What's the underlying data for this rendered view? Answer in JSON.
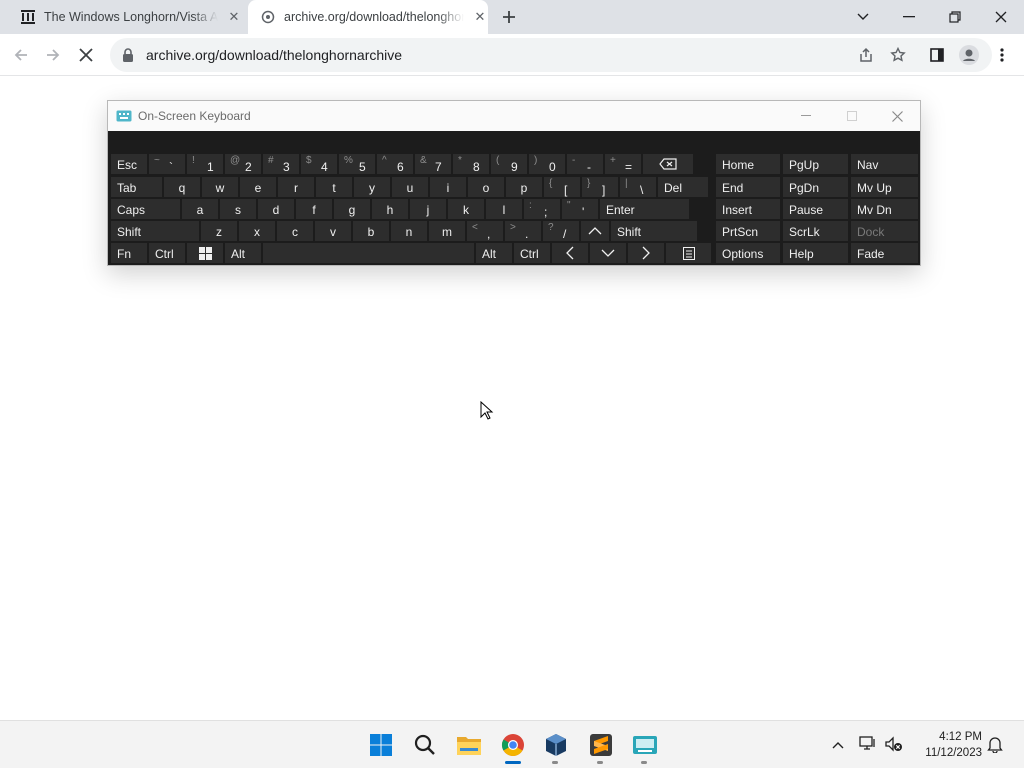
{
  "browser": {
    "tabs": [
      {
        "title": "The Windows Longhorn/Vista Archive",
        "active": false
      },
      {
        "title": "archive.org/download/thelonghornarchive",
        "active": true
      }
    ],
    "new_tab_icon": "plus-icon",
    "address": "archive.org/download/thelonghornarchive",
    "window_controls": [
      "chevron-down-icon",
      "minimize-icon",
      "restore-icon",
      "close-icon"
    ],
    "toolbar_icons": [
      "share-icon",
      "star-icon",
      "side-panel-icon",
      "profile-icon",
      "menu-icon"
    ]
  },
  "osk": {
    "title": "On-Screen Keyboard",
    "rows": [
      [
        {
          "l": "Esc"
        },
        {
          "s": "~",
          "m": "`"
        },
        {
          "s": "!",
          "m": "1"
        },
        {
          "s": "@",
          "m": "2"
        },
        {
          "s": "#",
          "m": "3"
        },
        {
          "s": "$",
          "m": "4"
        },
        {
          "s": "%",
          "m": "5"
        },
        {
          "s": "^",
          "m": "6"
        },
        {
          "s": "&",
          "m": "7"
        },
        {
          "s": "*",
          "m": "8"
        },
        {
          "s": "(",
          "m": "9"
        },
        {
          "s": ")",
          "m": "0"
        },
        {
          "s": "-",
          "m": "-"
        },
        {
          "s": "+",
          "m": "="
        },
        {
          "icon": "backspace-icon"
        }
      ],
      [
        {
          "l": "Tab"
        },
        {
          "l": "q"
        },
        {
          "l": "w"
        },
        {
          "l": "e"
        },
        {
          "l": "r"
        },
        {
          "l": "t"
        },
        {
          "l": "y"
        },
        {
          "l": "u"
        },
        {
          "l": "i"
        },
        {
          "l": "o"
        },
        {
          "l": "p"
        },
        {
          "s": "{",
          "m": "["
        },
        {
          "s": "}",
          "m": "]"
        },
        {
          "s": "|",
          "m": "\\"
        },
        {
          "l": "Del"
        }
      ],
      [
        {
          "l": "Caps"
        },
        {
          "l": "a"
        },
        {
          "l": "s"
        },
        {
          "l": "d"
        },
        {
          "l": "f"
        },
        {
          "l": "g"
        },
        {
          "l": "h"
        },
        {
          "l": "j"
        },
        {
          "l": "k"
        },
        {
          "l": "l"
        },
        {
          "s": ":",
          "m": ";"
        },
        {
          "s": "\"",
          "m": "'"
        },
        {
          "l": "Enter"
        }
      ],
      [
        {
          "l": "Shift"
        },
        {
          "l": "z"
        },
        {
          "l": "x"
        },
        {
          "l": "c"
        },
        {
          "l": "v"
        },
        {
          "l": "b"
        },
        {
          "l": "n"
        },
        {
          "l": "m"
        },
        {
          "s": "<",
          "m": ","
        },
        {
          "s": ">",
          "m": "."
        },
        {
          "s": "?",
          "m": "/"
        },
        {
          "icon": "arrow-up-icon"
        },
        {
          "l": "Shift"
        }
      ],
      [
        {
          "l": "Fn"
        },
        {
          "l": "Ctrl"
        },
        {
          "icon": "windows-icon"
        },
        {
          "l": "Alt"
        },
        {
          "l": ""
        },
        {
          "l": "Alt"
        },
        {
          "l": "Ctrl"
        },
        {
          "icon": "arrow-left-icon"
        },
        {
          "icon": "arrow-down-icon"
        },
        {
          "icon": "arrow-right-icon"
        },
        {
          "icon": "context-menu-icon"
        }
      ]
    ],
    "nav_keys": [
      [
        "Home",
        "PgUp",
        "Nav"
      ],
      [
        "End",
        "PgDn",
        "Mv Up"
      ],
      [
        "Insert",
        "Pause",
        "Mv Dn"
      ],
      [
        "PrtScn",
        "ScrLk",
        "Dock"
      ],
      [
        "Options",
        "Help",
        "Fade"
      ]
    ]
  },
  "taskbar": {
    "apps": [
      "windows-start-icon",
      "search-icon",
      "file-explorer-icon",
      "chrome-icon",
      "virtualbox-icon",
      "sublime-icon",
      "keyboard-app-icon"
    ],
    "time": "4:12 PM",
    "date": "11/12/2023"
  }
}
